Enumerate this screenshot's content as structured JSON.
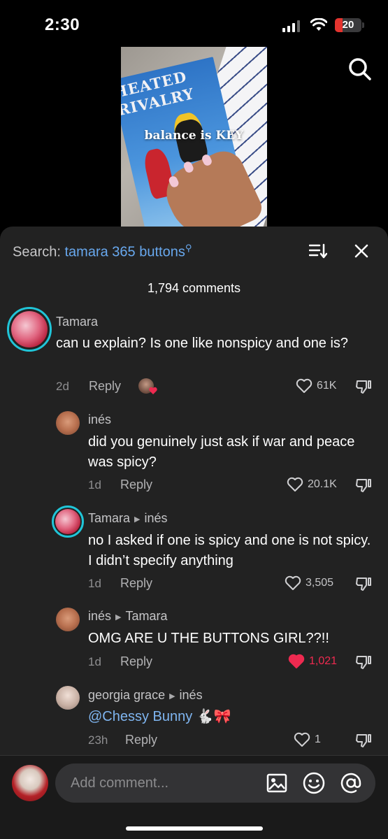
{
  "status_bar": {
    "time": "2:30",
    "battery": "20"
  },
  "video": {
    "overlay_text": "balance is KEY",
    "book_title_line1": "HEATED",
    "book_title_line2": "RIVALRY"
  },
  "comments_panel": {
    "search_label": "Search:",
    "search_query": "tamara 365 buttons",
    "comment_count": "1,794 comments"
  },
  "comments": [
    {
      "author": "Tamara",
      "reply_to": "",
      "text": "can u explain? Is one like nonspicy and one is?",
      "age": "2d",
      "reply_label": "Reply",
      "likes": "61K",
      "liked": false
    },
    {
      "author": "inés",
      "reply_to": "",
      "text": "did you genuinely just ask if war and peace was spicy?",
      "age": "1d",
      "reply_label": "Reply",
      "likes": "20.1K",
      "liked": false
    },
    {
      "author": "Tamara",
      "reply_to": "inés",
      "text": "no I asked if one is spicy and one is not spicy. I didn’t specify anything",
      "age": "1d",
      "reply_label": "Reply",
      "likes": "3,505",
      "liked": false
    },
    {
      "author": "inés",
      "reply_to": "Tamara",
      "text": "OMG ARE U THE BUTTONS GIRL??!!",
      "age": "1d",
      "reply_label": "Reply",
      "likes": "1,021",
      "liked": true
    },
    {
      "author": "georgia grace",
      "reply_to": "inés",
      "mention": "@Chessy Bunny",
      "emoji": "🐇🎀",
      "age": "23h",
      "reply_label": "Reply",
      "likes": "1",
      "liked": false
    }
  ],
  "composer": {
    "placeholder": "Add comment..."
  },
  "colors": {
    "accent_link": "#68a8ee",
    "like_red": "#ee2a50",
    "panel_bg": "#222222",
    "ring": "#20c5d8"
  },
  "icons": [
    "search-icon",
    "sort-icon",
    "close-icon",
    "heart-icon",
    "dislike-icon",
    "image-icon",
    "emoji-icon",
    "at-icon"
  ]
}
